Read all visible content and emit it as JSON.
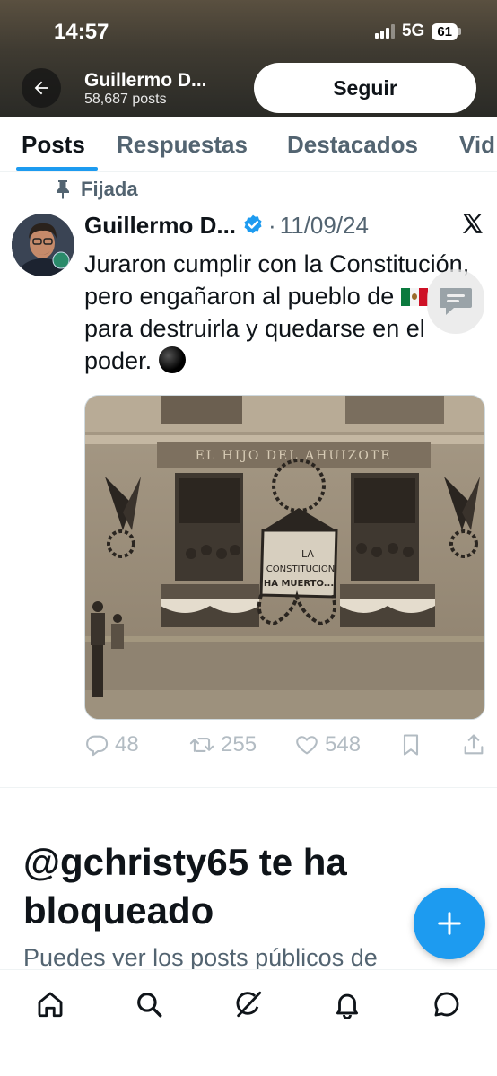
{
  "status_bar": {
    "time": "14:57",
    "network": "5G",
    "battery": "61"
  },
  "header": {
    "name": "Guillermo D...",
    "posts_count": "58,687 posts",
    "follow_label": "Seguir"
  },
  "tabs": [
    "Posts",
    "Respuestas",
    "Destacados",
    "Vid"
  ],
  "pinned_label": "Fijada",
  "tweet": {
    "author": "Guillermo D...",
    "separator": "·",
    "date": "11/09/24",
    "text_part1": "Juraron cumplir con la Constitución, pero engañaron al pueblo de",
    "text_part2": "para destruirla y quedarse en el poder.",
    "image_signs": {
      "top": "EL HIJO DEL AHUIZOTE",
      "banner_line1": "LA",
      "banner_line2": "CONSTITUCION",
      "banner_line3": "HA MUERTO..."
    },
    "stats": {
      "replies": "48",
      "reposts": "255",
      "likes": "548"
    }
  },
  "blocked": {
    "title": "@gchristy65 te ha bloqueado",
    "description": "Puedes ver los posts públicos de"
  },
  "colors": {
    "accent": "#1d9bf0",
    "text": "#0f1419",
    "secondary": "#536471"
  },
  "icons": [
    "back-arrow-icon",
    "pin-icon",
    "verified-badge-icon",
    "x-logo-icon",
    "reply-icon",
    "repost-icon",
    "like-icon",
    "bookmark-icon",
    "share-icon",
    "compose-icon",
    "home-icon",
    "search-icon",
    "grok-icon",
    "notifications-icon",
    "messages-icon"
  ]
}
